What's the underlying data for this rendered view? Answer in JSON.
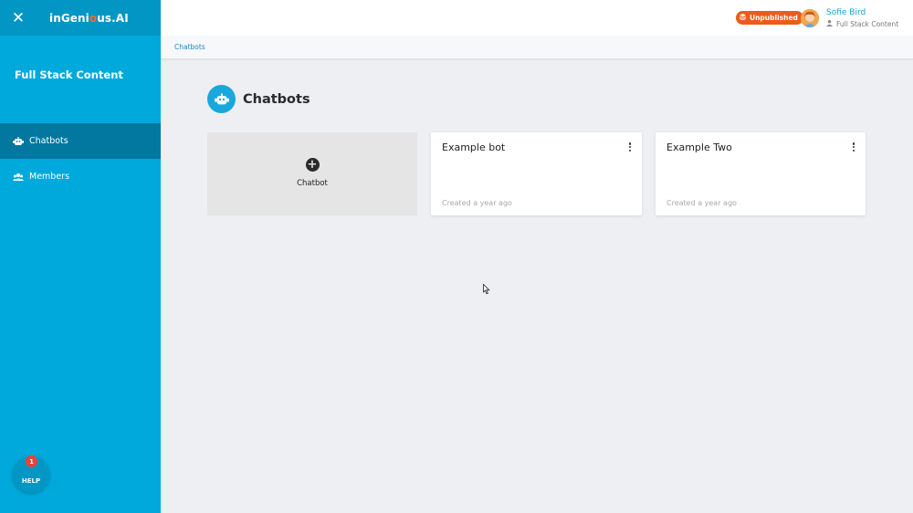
{
  "sidebar": {
    "close_icon": "close-icon",
    "logo_prefix": "inGeni",
    "logo_mark": "o",
    "logo_suffix": "us.AI",
    "workspace": "Full Stack Content",
    "items": [
      {
        "label": "Chatbots",
        "icon": "robot-icon",
        "active": true
      },
      {
        "label": "Members",
        "icon": "people-icon",
        "active": false
      }
    ],
    "help": {
      "label": "HELP",
      "badge": "1"
    }
  },
  "topbar": {
    "status": "Unpublished",
    "user_name": "Sofie Bird",
    "user_role": "Full Stack Content"
  },
  "breadcrumb": {
    "current": "Chatbots"
  },
  "main": {
    "title": "Chatbots",
    "add_card_label": "Chatbot",
    "bots": [
      {
        "name": "Example bot",
        "created": "Created a year ago"
      },
      {
        "name": "Example Two",
        "created": "Created a year ago"
      }
    ]
  },
  "colors": {
    "sidebar": "#00a9dc",
    "sidebar_header": "#0196c4",
    "sidebar_active": "#0277a0",
    "status": "#ec5a1c",
    "link": "#1a86c4",
    "background": "#eeeff2"
  }
}
